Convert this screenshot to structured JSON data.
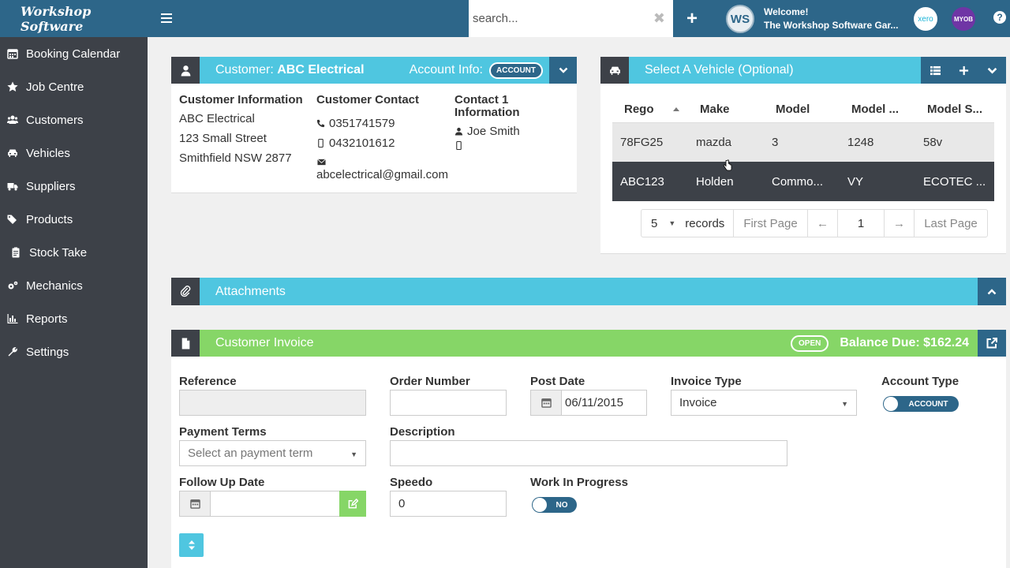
{
  "topbar": {
    "brand": "Workshop Software",
    "search_placeholder": "search...",
    "logo_text": "WS",
    "welcome": "Welcome!",
    "garage_name": "The Workshop Software Gar...",
    "xero_label": "xero",
    "myob_label": "MYOB",
    "help_label": "?"
  },
  "sidebar": {
    "items": [
      {
        "label": "Booking Calendar",
        "icon": "calendar-icon"
      },
      {
        "label": "Job Centre",
        "icon": "star-icon"
      },
      {
        "label": "Customers",
        "icon": "users-icon"
      },
      {
        "label": "Vehicles",
        "icon": "car-icon"
      },
      {
        "label": "Suppliers",
        "icon": "truck-icon"
      },
      {
        "label": "Products",
        "icon": "tags-icon"
      },
      {
        "label": "Stock Take",
        "icon": "clipboard-icon"
      },
      {
        "label": "Mechanics",
        "icon": "cogs-icon"
      },
      {
        "label": "Reports",
        "icon": "bar-chart-icon"
      },
      {
        "label": "Settings",
        "icon": "wrench-icon"
      }
    ]
  },
  "customer": {
    "title_prefix": "Customer: ",
    "name": "ABC Electrical",
    "account_info_label": "Account Info:",
    "account_pill": "ACCOUNT",
    "info_heading": "Customer Information",
    "info_lines": [
      "ABC Electrical",
      "123 Small Street",
      "Smithfield NSW 2877"
    ],
    "contact_heading": "Customer Contact",
    "phone": "0351741579",
    "mobile": "0432101612",
    "email": "abcelectrical@gmail.com",
    "contact1_heading": "Contact 1 Information",
    "contact1_name": "Joe Smith",
    "contact1_mobile": ""
  },
  "vehicle": {
    "title": "Select A Vehicle (Optional)",
    "columns": [
      "Rego",
      "Make",
      "Model",
      "Model ...",
      "Model S..."
    ],
    "rows": [
      [
        "78FG25",
        "mazda",
        "3",
        "1248",
        "58v"
      ],
      [
        "ABC123",
        "Holden",
        "Commo...",
        "VY",
        "ECOTEC ..."
      ]
    ],
    "pager": {
      "page_size": "5",
      "records_label": "records",
      "first": "First Page",
      "prev": "←",
      "page": "1",
      "next": "→",
      "last": "Last Page"
    }
  },
  "attachments": {
    "title": "Attachments"
  },
  "invoice": {
    "title": "Customer Invoice",
    "status": "OPEN",
    "balance": "Balance Due: $162.24",
    "reference_label": "Reference",
    "reference_value": "",
    "order_label": "Order Number",
    "order_value": "",
    "post_date_label": "Post Date",
    "post_date_value": "06/11/2015",
    "invoice_type_label": "Invoice Type",
    "invoice_type_value": "Invoice",
    "account_type_label": "Account Type",
    "account_type_value": "ACCOUNT",
    "payment_terms_label": "Payment Terms",
    "payment_terms_placeholder": "Select an payment term",
    "description_label": "Description",
    "description_value": "",
    "follow_up_label": "Follow Up Date",
    "follow_up_value": "",
    "speedo_label": "Speedo",
    "speedo_value": "0",
    "wip_label": "Work In Progress",
    "wip_value": "NO"
  },
  "colors": {
    "topbar": "#2d6689",
    "sidebar": "#3d4148",
    "cyan": "#4fc6e0",
    "green": "#86d667"
  }
}
